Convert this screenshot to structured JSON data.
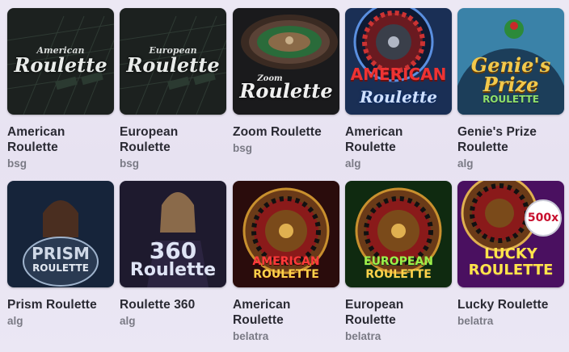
{
  "games": [
    {
      "title": "American Roulette",
      "provider": "bsg",
      "logo_top": "American",
      "logo_main": "Roulette"
    },
    {
      "title": "European Roulette",
      "provider": "bsg",
      "logo_top": "European",
      "logo_main": "Roulette"
    },
    {
      "title": "Zoom Roulette",
      "provider": "bsg",
      "logo_top": "Zoom",
      "logo_main": "Roulette"
    },
    {
      "title": "American Roulette",
      "provider": "alg",
      "logo_top": "AMERICAN",
      "logo_main": "Roulette"
    },
    {
      "title": "Genie's Prize Roulette",
      "provider": "alg",
      "logo_top": "Genie's",
      "logo_mid": "Prize",
      "logo_main": "ROULETTE"
    },
    {
      "title": "Prism Roulette",
      "provider": "alg",
      "logo_top": "PRISM",
      "logo_main": "ROULETTE"
    },
    {
      "title": "Roulette 360",
      "provider": "alg",
      "logo_top": "360",
      "logo_main": "Roulette"
    },
    {
      "title": "American Roulette",
      "provider": "belatra",
      "logo_top": "AMERICAN",
      "logo_main": "ROULETTE"
    },
    {
      "title": "European Roulette",
      "provider": "belatra",
      "logo_top": "EUROPEAN",
      "logo_main": "ROULETTE"
    },
    {
      "title": "Lucky Roulette",
      "provider": "belatra",
      "logo_top": "LUCKY",
      "logo_main": "ROULETTE",
      "badge": "500x"
    }
  ],
  "colors": {
    "title": "#2a2a33",
    "provider": "#7a7a85",
    "background": "#ebe7f3"
  }
}
